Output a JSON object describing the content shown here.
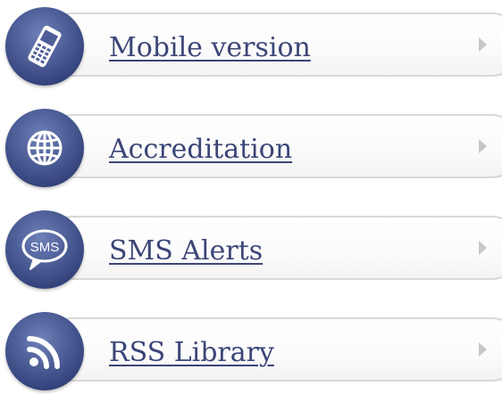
{
  "menu": {
    "items": [
      {
        "label": "Mobile version",
        "icon": "mobile-phone-icon"
      },
      {
        "label": "Accreditation",
        "icon": "globe-icon"
      },
      {
        "label": "SMS Alerts",
        "icon": "sms-bubble-icon",
        "icon_text": "SMS"
      },
      {
        "label": "RSS Library",
        "icon": "rss-icon"
      }
    ]
  },
  "colors": {
    "icon_circle": "#3f4f8a",
    "link_text": "#3b4577",
    "pill_border": "#d8d8d8",
    "chevron": "#c7c7c7"
  }
}
